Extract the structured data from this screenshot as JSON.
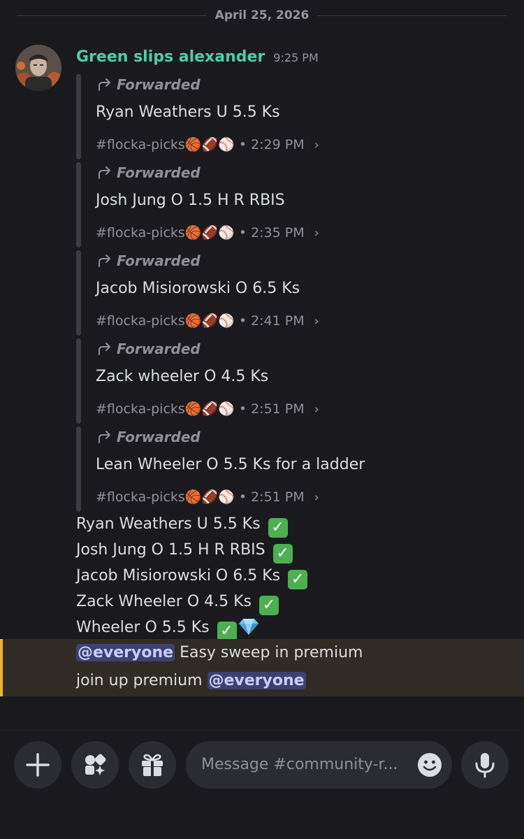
{
  "date_divider": "April 25, 2026",
  "message": {
    "author": "Green slips alexander",
    "time": "9:25 PM"
  },
  "forwards": [
    {
      "label": "Forwarded",
      "text": "Ryan Weathers U 5.5 Ks",
      "channel": "#flocka-picks",
      "emojis": "🏀🏈⚾",
      "time": "2:29 PM"
    },
    {
      "label": "Forwarded",
      "text": "Josh Jung O 1.5 H R RBIS",
      "channel": "#flocka-picks",
      "emojis": "🏀🏈⚾",
      "time": "2:35 PM"
    },
    {
      "label": "Forwarded",
      "text": "Jacob Misiorowski O 6.5 Ks",
      "channel": "#flocka-picks",
      "emojis": "🏀🏈⚾",
      "time": "2:41 PM"
    },
    {
      "label": "Forwarded",
      "text": "Zack wheeler O 4.5 Ks",
      "channel": "#flocka-picks",
      "emojis": "🏀🏈⚾",
      "time": "2:51 PM"
    },
    {
      "label": "Forwarded",
      "text": "Lean Wheeler O 5.5 Ks for a ladder",
      "channel": "#flocka-picks",
      "emojis": "🏀🏈⚾",
      "time": "2:51 PM"
    }
  ],
  "results": [
    "Ryan Weathers U 5.5 Ks",
    "Josh Jung O 1.5 H R RBIS",
    "Jacob Misiorowski O 6.5 Ks",
    "Zack Wheeler O 4.5 Ks",
    "Wheeler O 5.5 Ks"
  ],
  "mention_message": {
    "mention": "@everyone",
    "line1_text": " Easy sweep in premium",
    "line2_text": "join up premium "
  },
  "input": {
    "placeholder": "Message #community-r..."
  },
  "icons": {
    "add": "plus-icon",
    "apps": "apps-icon",
    "gift": "gift-icon",
    "emoji": "smiley-icon",
    "voice": "microphone-icon",
    "forward": "forward-arrow-icon",
    "check": "check-icon",
    "diamond": "gem-icon"
  },
  "colors": {
    "background": "#1a1a1e",
    "author": "#4dcea5",
    "check": "#4caf50",
    "mention_bg": "#3c4270",
    "highlight_bg": "#302b24",
    "highlight_accent": "#f0b232"
  }
}
